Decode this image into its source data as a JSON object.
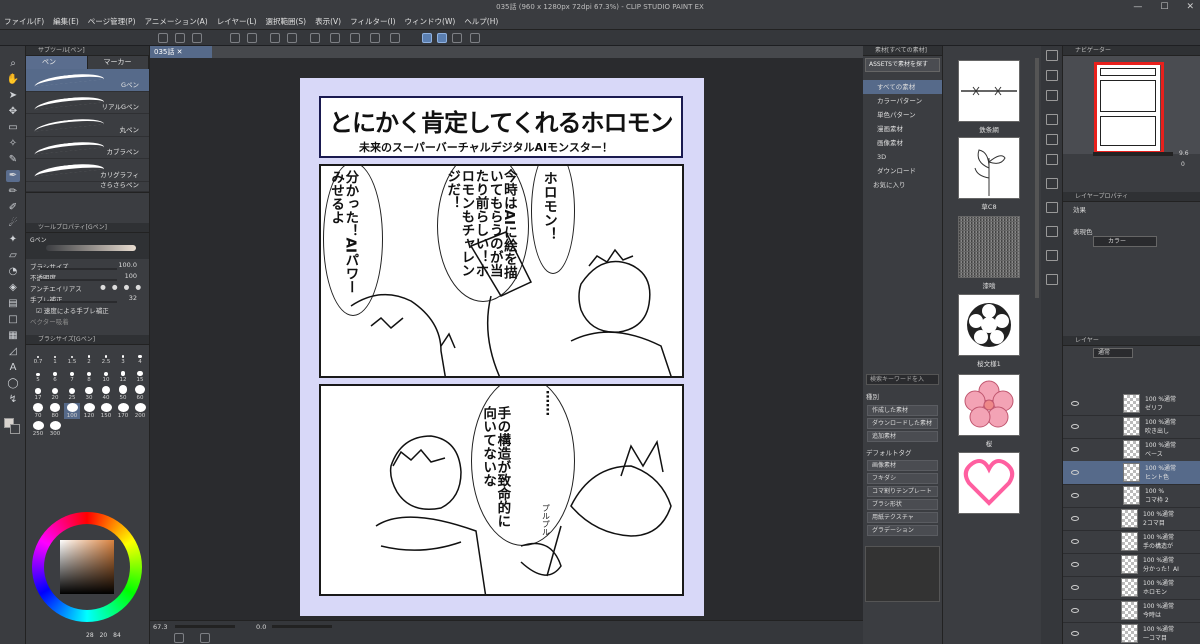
{
  "window": {
    "title": "035話 (960 x 1280px 72dpi 67.3%) - CLIP STUDIO PAINT EX",
    "controls": [
      "—",
      "☐",
      "✕"
    ]
  },
  "menu": [
    "ファイル(F)",
    "編集(E)",
    "ページ管理(P)",
    "アニメーション(A)",
    "レイヤー(L)",
    "選択範囲(S)",
    "表示(V)",
    "フィルター(I)",
    "ウィンドウ(W)",
    "ヘルプ(H)"
  ],
  "subtool": {
    "header": "サブツール[ペン]",
    "tabs": [
      "ペン",
      "マーカー"
    ],
    "brushes": [
      "Gペン",
      "リアルGペン",
      "丸ペン",
      "カブラペン",
      "カリグラフィ",
      "さらさらペン"
    ]
  },
  "toolprop": {
    "header": "ツールプロパティ[Gペン]",
    "current": "Gペン",
    "rows": [
      {
        "label": "ブラシサイズ",
        "value": "100.0"
      },
      {
        "label": "不透明度",
        "value": "100"
      },
      {
        "label": "アンチエイリアス",
        "value": ""
      },
      {
        "label": "手ブレ補正",
        "value": "32"
      },
      {
        "label": "速度による手ブレ補正",
        "value": ""
      },
      {
        "label": "ベクター吸着",
        "value": ""
      }
    ]
  },
  "brushsize": {
    "header": "ブラシサイズ[Gペン]",
    "sizes": [
      "0.7",
      "1",
      "1.5",
      "2",
      "2.5",
      "3",
      "4",
      "5",
      "6",
      "7",
      "8",
      "10",
      "12",
      "15",
      "17",
      "20",
      "25",
      "30",
      "40",
      "50",
      "60",
      "70",
      "80",
      "100",
      "120",
      "150",
      "170",
      "200",
      "250",
      "300"
    ],
    "selected": "100"
  },
  "colorbar": {
    "values": [
      "28",
      "20",
      "84"
    ]
  },
  "canvas": {
    "doc_tab": "035話",
    "zoom": "67.3",
    "rotate": "0.0"
  },
  "comic": {
    "title": "とにかく肯定してくれるホロモン",
    "subtitle": "未来のスーパーバーチャルデジタルAIモンスター！",
    "balloon1": "ホロモン！",
    "balloon2": "今時はAIに絵を描いてもらうのが当たり前らしい！ホロモンもチャレンジだ！",
    "balloon3": "分かった！AIパワーみせるよ",
    "balloon4": "……",
    "balloon5": "手の構造が致命的に向いてないな",
    "sfx": "プルプル"
  },
  "materials": {
    "header": "素材[すべての素材]",
    "assets_btn": "ASSETSで素材を探す",
    "tree": [
      "すべての素材",
      "カラーパターン",
      "単色パターン",
      "漫画素材",
      "画像素材",
      "3D",
      "ダウンロード",
      "お気に入り"
    ],
    "search_placeholder": "検索キーワードを入",
    "kind_label": "種別",
    "kinds": [
      "作成した素材",
      "ダウンロードした素材",
      "追加素材"
    ],
    "tags_label": "デフォルトタグ",
    "tags": [
      "画像素材",
      "フキダシ",
      "コマ割りテンプレート",
      "ブラシ形状",
      "用紙テクスチャ",
      "グラデーション"
    ],
    "items": [
      "鉄条網",
      "草C8",
      "漆喰",
      "桜文様1",
      "桜",
      ""
    ]
  },
  "navigator": {
    "header": "ナビゲーター",
    "zoom": "9.6",
    "rotate": "0"
  },
  "layerprop": {
    "header": "レイヤープロパティ",
    "effect_label": "効果",
    "color_label": "表現色",
    "color_value": "カラー"
  },
  "layers": {
    "header": "レイヤー",
    "blend": "通常",
    "items": [
      {
        "pct": "100 %通常",
        "name": "ゼリフ"
      },
      {
        "pct": "100 %通常",
        "name": "吹き出し"
      },
      {
        "pct": "100 %通常",
        "name": "ベース"
      },
      {
        "pct": "100 %通常",
        "name": "ヒント色"
      },
      {
        "pct": "100 %",
        "name": "コマ枠 2"
      },
      {
        "pct": "100 %通常",
        "name": "2コマ目"
      },
      {
        "pct": "100 %通常",
        "name": "手の構造が"
      },
      {
        "pct": "100 %通常",
        "name": "分かった！AI"
      },
      {
        "pct": "100 %通常",
        "name": "ホロモン"
      },
      {
        "pct": "100 %通常",
        "name": "今時は"
      },
      {
        "pct": "100 %通常",
        "name": "一コマ目"
      }
    ]
  },
  "colors": {
    "accent": "#566a8a",
    "highlight_frame": "#e8201c",
    "page_bg": "#d8d8f8",
    "title_border": "#1a1a50"
  }
}
